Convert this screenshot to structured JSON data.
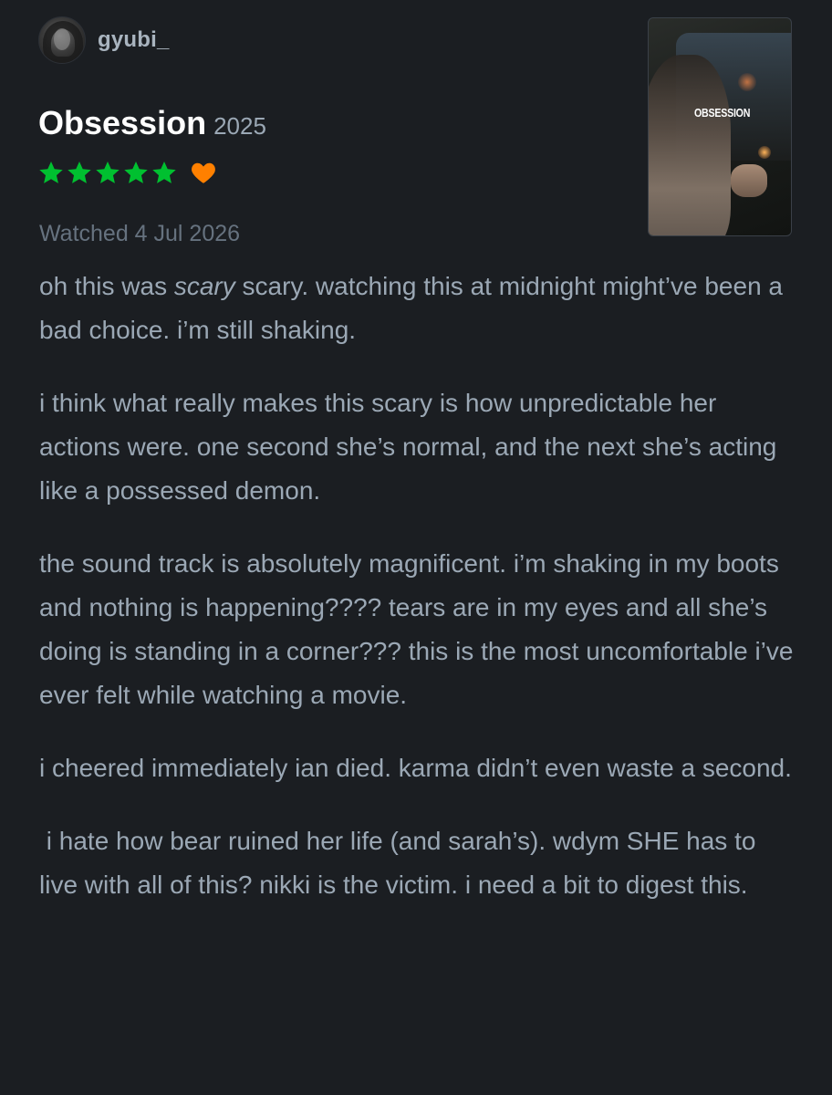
{
  "user": {
    "username": "gyubi_"
  },
  "film": {
    "title": "Obsession",
    "year": "2025",
    "poster_title": "OBSESSION"
  },
  "rating": {
    "stars": 5,
    "liked": true,
    "star_color": "#00c030",
    "heart_color": "#ff8000"
  },
  "watched": {
    "text": "Watched 4 Jul 2026"
  },
  "review": {
    "p1_before": "oh this was ",
    "p1_emphasis": "scary",
    "p1_after": " scary. watching this at midnight might’ve been a bad choice. i’m still shaking.",
    "p2": "i think what really makes this scary is how unpredictable her actions were. one second she’s normal, and the next she’s acting like a possessed demon.",
    "p3": "the sound track is absolutely magnificent. i’m shaking in my boots and nothing is happening???? tears are in my eyes and all she’s doing is standing in a corner??? this is the most uncomfortable i’ve ever felt while watching a movie.",
    "p4": "i cheered immediately ian died. karma didn’t even waste a second.",
    "p5": " i hate how bear ruined her life (and sarah’s). wdym SHE has to live with all of this? nikki is the victim. i need a bit to digest this."
  },
  "icons": {
    "star": "star-icon",
    "heart": "heart-icon"
  }
}
